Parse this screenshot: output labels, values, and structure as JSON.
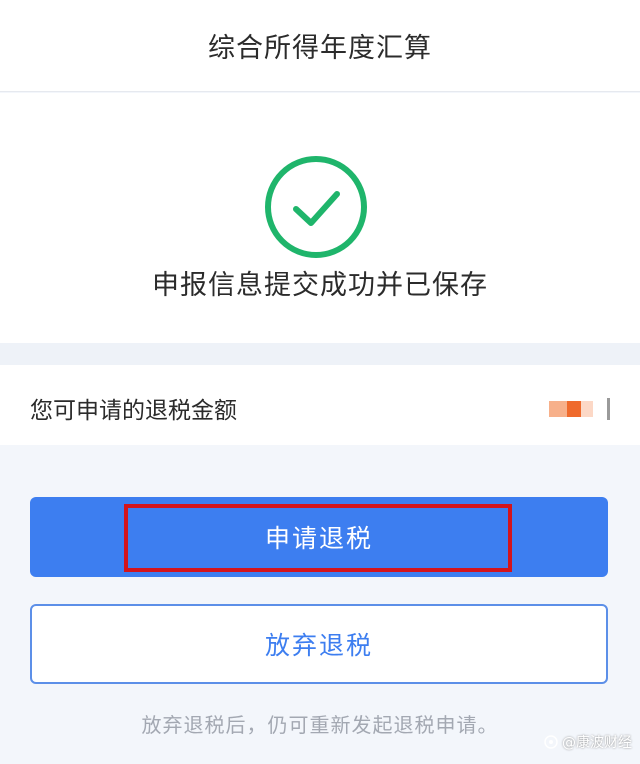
{
  "header": {
    "title": "综合所得年度汇算"
  },
  "result": {
    "message": "申报信息提交成功并已保存"
  },
  "refund": {
    "label": "您可申请的退税金额"
  },
  "actions": {
    "apply_label": "申请退税",
    "abandon_label": "放弃退税"
  },
  "notice": "放弃退税后，仍可重新发起退税申请。",
  "watermark": {
    "text": "@康波财经"
  },
  "colors": {
    "accent": "#3d7ef0",
    "success": "#1fb56b",
    "highlight": "#d3141c"
  },
  "icons": {
    "success": "check-circle-icon",
    "watermark": "logo-icon"
  }
}
